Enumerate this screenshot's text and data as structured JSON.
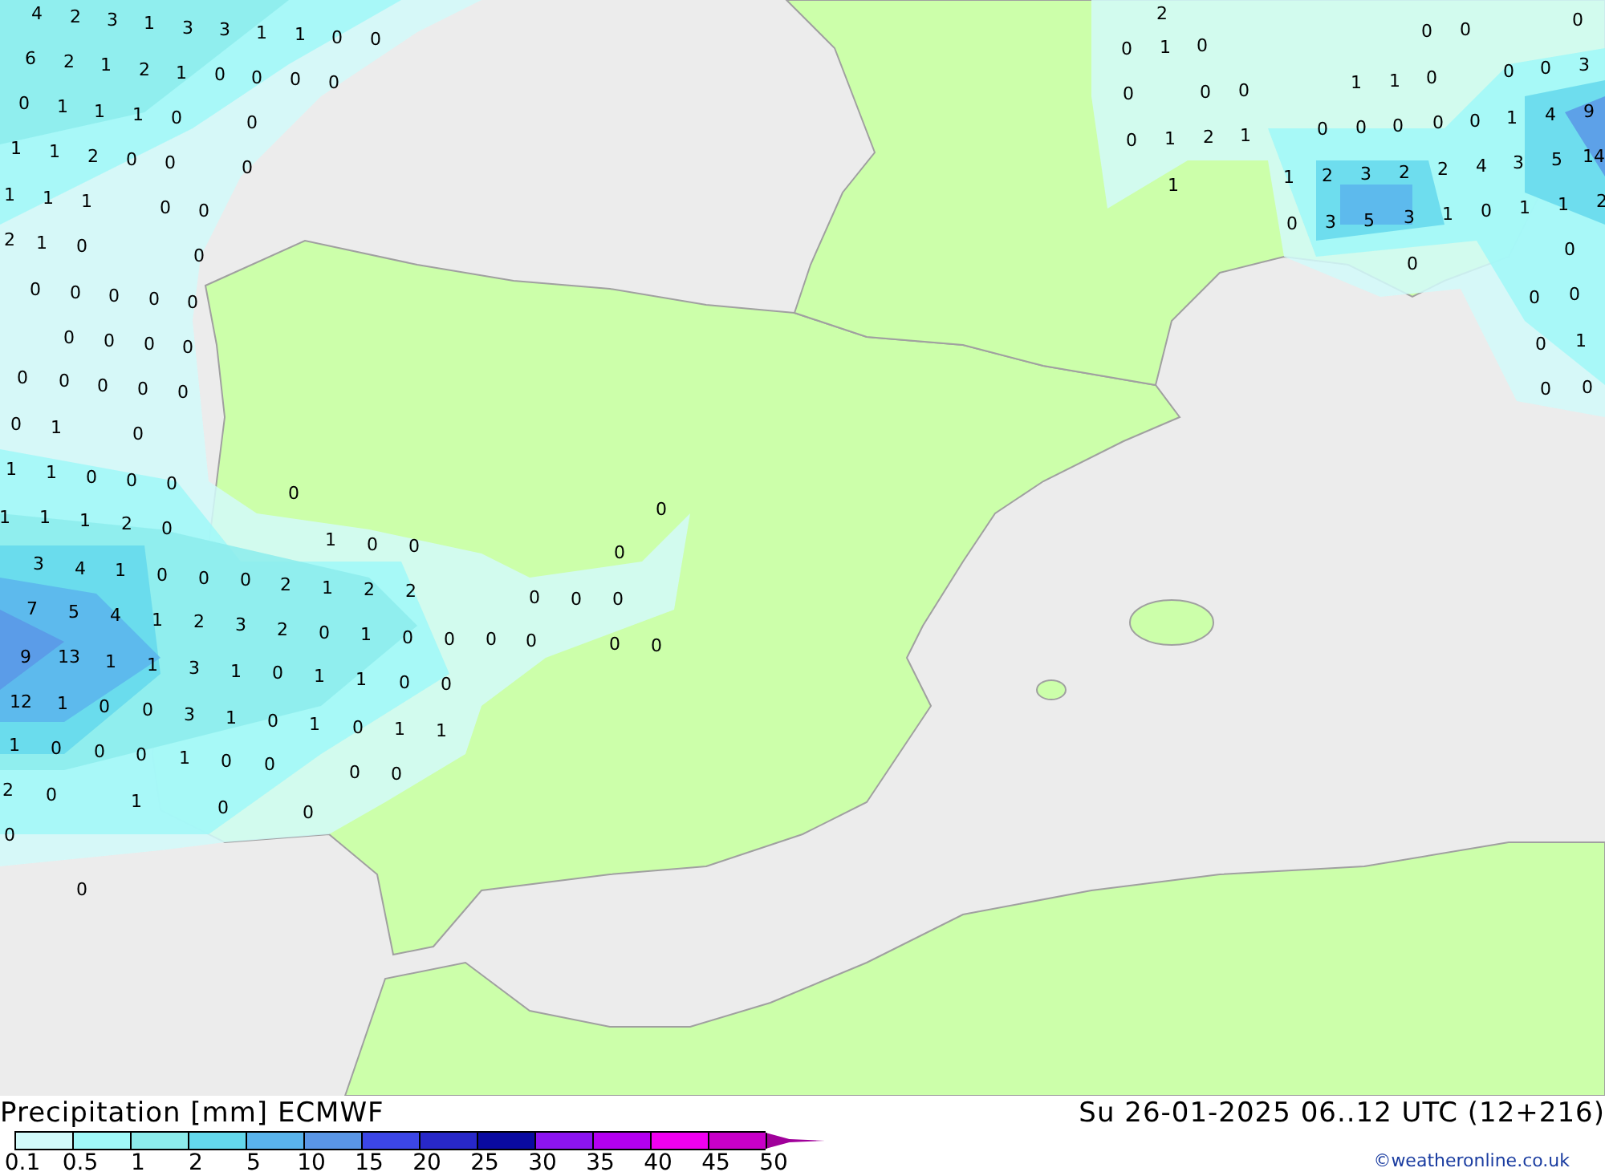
{
  "map": {
    "values": [
      "4",
      "2",
      "3",
      "1",
      "3",
      "3",
      "1",
      "1",
      "0",
      "0",
      "6",
      "2",
      "1",
      "2",
      "1",
      "0",
      "0",
      "0",
      "0",
      "0",
      "1",
      "1",
      "1",
      "0",
      "0",
      "1",
      "1",
      "2",
      "0",
      "0",
      "0",
      "1",
      "1",
      "1",
      "0",
      "0",
      "2",
      "1",
      "0",
      "0",
      "0",
      "0",
      "0",
      "0",
      "0",
      "0",
      "0",
      "0",
      "0",
      "0",
      "0",
      "0",
      "0",
      "0",
      "0",
      "1",
      "0",
      "1",
      "1",
      "0",
      "0",
      "0",
      "0",
      "1",
      "1",
      "1",
      "2",
      "0",
      "1",
      "0",
      "0",
      "3",
      "4",
      "1",
      "0",
      "0",
      "0",
      "2",
      "1",
      "2",
      "2",
      "7",
      "5",
      "4",
      "1",
      "2",
      "3",
      "2",
      "0",
      "1",
      "0",
      "0",
      "0",
      "0",
      "0",
      "0",
      "9",
      "13",
      "1",
      "1",
      "3",
      "1",
      "0",
      "1",
      "1",
      "0",
      "0",
      "12",
      "1",
      "0",
      "0",
      "3",
      "1",
      "0",
      "1",
      "0",
      "1",
      "1",
      "1",
      "0",
      "0",
      "0",
      "1",
      "0",
      "0",
      "0",
      "0",
      "2",
      "0",
      "1",
      "0",
      "0",
      "0",
      "0",
      "0",
      "0",
      "0",
      "0",
      "0",
      "2",
      "0",
      "1",
      "0",
      "0",
      "0",
      "0",
      "0",
      "0",
      "0",
      "1",
      "1",
      "0",
      "0",
      "1",
      "2",
      "1",
      "0",
      "0",
      "0",
      "0",
      "0",
      "1",
      "4",
      "9",
      "0",
      "0",
      "3",
      "1",
      "1",
      "2",
      "3",
      "2",
      "2",
      "4",
      "3",
      "5",
      "14",
      "0",
      "3",
      "5",
      "3",
      "1",
      "0",
      "1",
      "1",
      "2",
      "0",
      "0",
      "0",
      "0",
      "0",
      "1",
      "0",
      "0"
    ]
  },
  "legend": {
    "title": "Precipitation [mm] ECMWF",
    "valid": "Su 26-01-2025 06..12 UTC (12+216)",
    "bins": [
      {
        "color": "#d2fafa"
      },
      {
        "color": "#a0f8f8"
      },
      {
        "color": "#8cecec"
      },
      {
        "color": "#64d8ec"
      },
      {
        "color": "#5ab4ec"
      },
      {
        "color": "#5a96e6"
      },
      {
        "color": "#3c46e6"
      },
      {
        "color": "#2828c8"
      },
      {
        "color": "#0a0aa0"
      },
      {
        "color": "#8c14f0"
      },
      {
        "color": "#b400f0"
      },
      {
        "color": "#f000f0"
      },
      {
        "color": "#c800c8"
      }
    ],
    "ticks": [
      "0.1",
      "0.5",
      "1",
      "2",
      "5",
      "10",
      "15",
      "20",
      "25",
      "30",
      "35",
      "40",
      "45",
      "50"
    ],
    "credit": "©weatheronline.co.uk"
  }
}
